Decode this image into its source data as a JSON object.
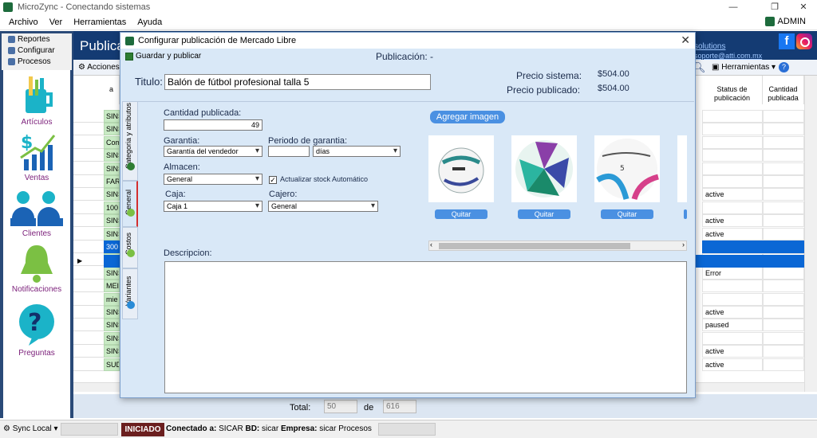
{
  "window": {
    "title": "MicroZync - Conectando sistemas",
    "minimize": "—",
    "maximize": "❐",
    "close": "✕"
  },
  "menu": {
    "items": [
      "Archivo",
      "Ver",
      "Herramientas",
      "Ayuda"
    ],
    "user": "ADMIN"
  },
  "nav": {
    "tabs": [
      "Reportes",
      "Configurar",
      "Procesos"
    ],
    "items": [
      "Artículos",
      "Ventas",
      "Clientes",
      "Notificaciones",
      "Preguntas"
    ]
  },
  "main": {
    "title": "Publica",
    "link1": "solutions",
    "link2": "soporte@atti.com.mx",
    "toolbar": {
      "acciones": "Acciones",
      "herramientas": "Herramientas"
    },
    "columns": {
      "status": "Status de publicación",
      "cantidad": "Cantidad publicada",
      "first": "a"
    },
    "rows": [
      {
        "code": "SINS",
        "status": ""
      },
      {
        "code": "SINS",
        "status": ""
      },
      {
        "code": "Com",
        "status": ""
      },
      {
        "code": "SINS",
        "status": ""
      },
      {
        "code": "SINS",
        "status": ""
      },
      {
        "code": "FAR",
        "status": ""
      },
      {
        "code": "SINS",
        "status": "active"
      },
      {
        "code": "100",
        "status": ""
      },
      {
        "code": "SINS",
        "status": "active"
      },
      {
        "code": "SINS",
        "status": "active"
      },
      {
        "code": "300",
        "status": ""
      },
      {
        "code": "SINS",
        "status": ""
      },
      {
        "code": "SINS",
        "status": "Error"
      },
      {
        "code": "MEI",
        "status": ""
      },
      {
        "code": "mie",
        "status": ""
      },
      {
        "code": "SINS",
        "status": "active"
      },
      {
        "code": "SINS",
        "status": "paused"
      },
      {
        "code": "SINS",
        "status": ""
      },
      {
        "code": "SINS",
        "status": "active"
      },
      {
        "code": "SUD",
        "status": "active"
      }
    ],
    "total_label": "Total:",
    "total_value": "50",
    "de_label": "de",
    "de_value": "616"
  },
  "status": {
    "sync": "Sync Local",
    "state": "INICIADO",
    "conectado_label": "Conectado a:",
    "conectado": "SICAR",
    "bd_label": "BD:",
    "bd": "sicar",
    "empresa_label": "Empresa:",
    "empresa": "sicar",
    "proceso": "Procesos"
  },
  "dialog": {
    "title": "Configurar publicación de Mercado Libre",
    "save": "Guardar y publicar",
    "publicacion": "Publicación:  -",
    "titulo_label": "Titulo:",
    "titulo_value": "Balón de fútbol profesional talla 5",
    "precio_sistema_label": "Precio sistema:",
    "precio_sistema": "$504.00",
    "precio_publicado_label": "Precio publicado:",
    "precio_publicado": "$504.00",
    "tabs": [
      "Categoria y atributos",
      "General",
      "Costos",
      "Variantes"
    ],
    "cantidad_label": "Cantidad publicada:",
    "cantidad": "49",
    "garantia_label": "Garantia:",
    "garantia": "Garantía del vendedor",
    "periodo_label": "Periodo de garantia:",
    "periodo_valor": "",
    "periodo_unidad": "días",
    "almacen_label": "Almacen:",
    "almacen": "General",
    "actualizar": "Actualizar stock Automático",
    "caja_label": "Caja:",
    "caja": "Caja 1",
    "cajero_label": "Cajero:",
    "cajero": "General",
    "agregar": "Agregar imagen",
    "quitar": "Quitar",
    "descripcion_label": "Descripcion:"
  },
  "colors": {
    "navy": "#143b73",
    "accent": "#4a90e2",
    "green_cell": "#c8eac4",
    "selected": "#0a67d5"
  }
}
